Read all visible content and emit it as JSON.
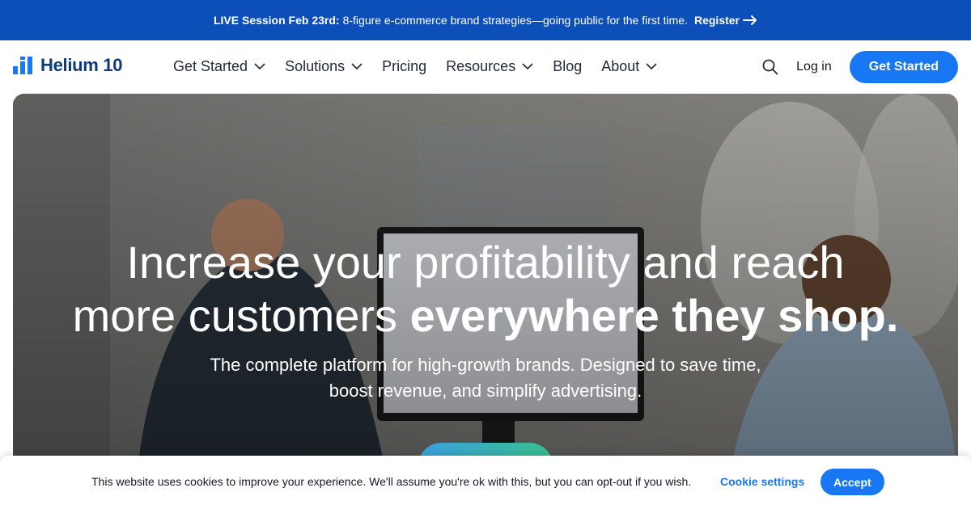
{
  "promo": {
    "bold": "LIVE Session Feb 23rd:",
    "text": "8-figure e-commerce brand strategies—going public for the first time.",
    "link": "Register",
    "icon": "arrow-right-icon"
  },
  "nav": {
    "logo_text": "Helium 10",
    "items": [
      {
        "label": "Get Started",
        "dropdown": true
      },
      {
        "label": "Solutions",
        "dropdown": true
      },
      {
        "label": "Pricing",
        "dropdown": false
      },
      {
        "label": "Resources",
        "dropdown": true
      },
      {
        "label": "Blog",
        "dropdown": false
      },
      {
        "label": "About",
        "dropdown": true
      }
    ],
    "login": "Log in",
    "cta": "Get Started"
  },
  "hero": {
    "title_line1": "Increase your profitability and reach",
    "title_line2_regular": "more customers",
    "title_line2_bold": "everywhere they shop.",
    "subtitle": "The complete platform for high-growth brands. Designed to save time, boost revenue, and simplify advertising.",
    "cta_label": ""
  },
  "cookie": {
    "text": "This website uses cookies to improve your experience. We'll assume you're ok with this, but you can opt-out if you wish.",
    "settings": "Cookie settings",
    "accept": "Accept"
  },
  "colors": {
    "promo_bg": "#0c4fb8",
    "primary": "#1877f2",
    "logo": "#0c3a7a"
  }
}
